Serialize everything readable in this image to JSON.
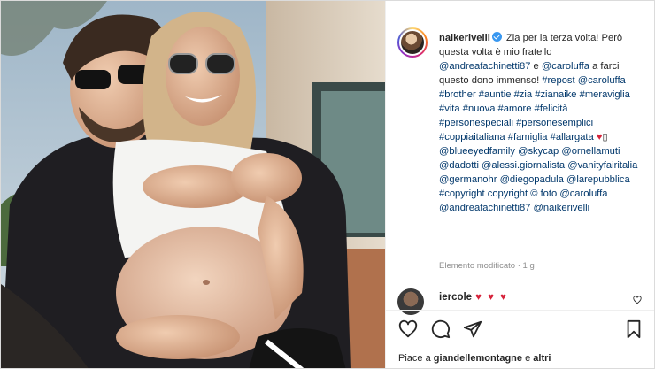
{
  "post": {
    "username": "naikerivelli",
    "caption": {
      "intro": "Zia per la terza volta! Però questa volta è mio fratello",
      "mention_1": "@andreafachinetti87",
      "and": "e",
      "mention_2": "@caroluffa",
      "outro": "a farci questo dono immenso!",
      "tags_1": "#repost @caroluffa #brother #auntie #zia #zianaike #meraviglia #vita #nuova #amore #felicità #personespeciali #personesemplici #coppiaitaliana #famiglia #allargata",
      "heart": "♥",
      "missing_glyph": "▯",
      "tags_2": "@blueeyedfamily @skycap @ornellamuti @dadotti @alessi.giornalista @vanityfairitalia @germanohr @diegopadula @larepubblica",
      "copyright": "#copyright copyright © foto",
      "credit_1": "@caroluffa",
      "credit_2": "@andreafachinetti87 @naikerivelli"
    },
    "edited_label": "Elemento modificato",
    "separator": "·",
    "age": "1 g"
  },
  "comment": {
    "username": "iercole",
    "hearts": "♥ ♥ ♥"
  },
  "likes": {
    "prefix": "Piace a",
    "user": "giandellemontagne",
    "conj": "e",
    "others": "altri"
  },
  "icons": {
    "like": "heart-outline-icon",
    "comment": "comment-icon",
    "share": "send-icon",
    "save": "bookmark-icon"
  },
  "colors": {
    "link": "#00376b",
    "verified": "#3897f0",
    "heart": "#d6223a",
    "muted": "#8e8e8e"
  }
}
